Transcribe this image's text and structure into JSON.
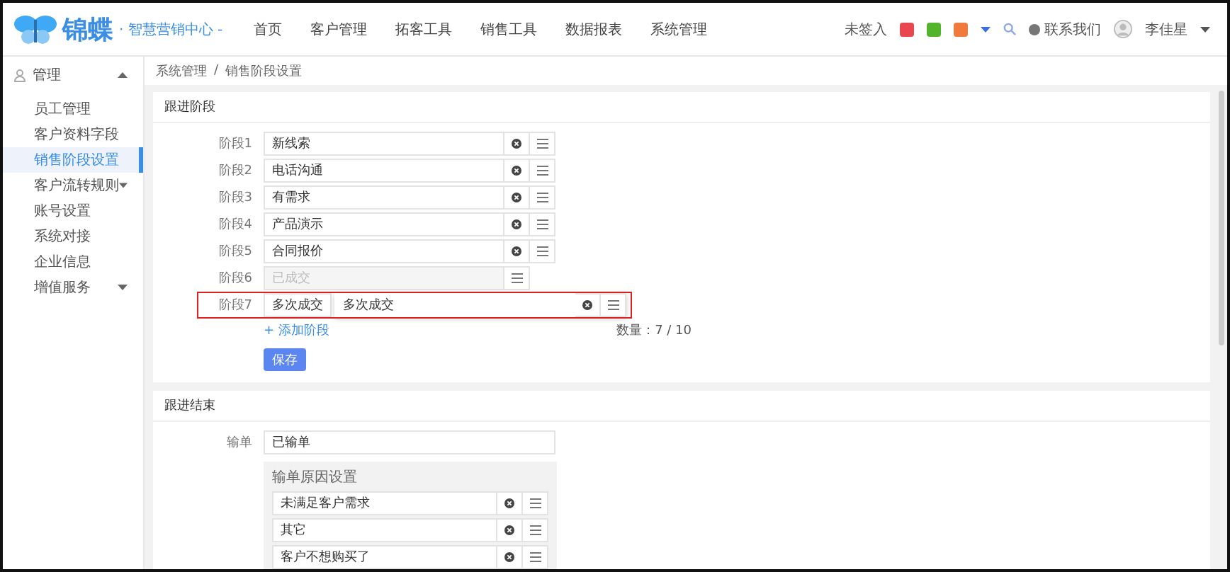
{
  "header": {
    "logo_text": "锦蝶",
    "logo_subtitle": "· 智慧营销中心 -",
    "nav": [
      {
        "label": "首页",
        "selected": false
      },
      {
        "label": "客户管理",
        "selected": false
      },
      {
        "label": "拓客工具",
        "selected": false
      },
      {
        "label": "销售工具",
        "selected": false
      },
      {
        "label": "数据报表",
        "selected": false
      },
      {
        "label": "系统管理",
        "selected": false
      }
    ],
    "status": "未签入",
    "quick_icons": [
      {
        "color": "#e8474f"
      },
      {
        "color": "#52b42c"
      },
      {
        "color": "#f07a3c"
      }
    ],
    "contact": "联系我们",
    "user": "李佳星"
  },
  "sidebar": {
    "group": {
      "label": "管理",
      "expanded": true
    },
    "items": [
      {
        "label": "员工管理",
        "selected": false,
        "has_children": false
      },
      {
        "label": "客户资料字段",
        "selected": false,
        "has_children": false
      },
      {
        "label": "销售阶段设置",
        "selected": true,
        "has_children": false
      },
      {
        "label": "客户流转规则",
        "selected": false,
        "has_children": true
      },
      {
        "label": "账号设置",
        "selected": false,
        "has_children": false
      },
      {
        "label": "系统对接",
        "selected": false,
        "has_children": false
      },
      {
        "label": "企业信息",
        "selected": false,
        "has_children": false
      },
      {
        "label": "增值服务",
        "selected": false,
        "has_children": true
      }
    ]
  },
  "breadcrumb": {
    "items": [
      "系统管理",
      "销售阶段设置"
    ],
    "separator": "/"
  },
  "stages_card": {
    "title": "跟进阶段",
    "stages": [
      {
        "label": "阶段1",
        "value": "新线索",
        "disabled": false,
        "dragging": false
      },
      {
        "label": "阶段2",
        "value": "电话沟通",
        "disabled": false,
        "dragging": false
      },
      {
        "label": "阶段3",
        "value": "有需求",
        "disabled": false,
        "dragging": false
      },
      {
        "label": "阶段4",
        "value": "产品演示",
        "disabled": false,
        "dragging": false
      },
      {
        "label": "阶段5",
        "value": "合同报价",
        "disabled": false,
        "dragging": false
      },
      {
        "label": "阶段6",
        "value": "已成交",
        "disabled": true,
        "dragging": false
      },
      {
        "label": "阶段7",
        "value": "多次成交",
        "disabled": false,
        "dragging": true,
        "ghost_value": "多次成交"
      }
    ],
    "add_link": "+ 添加阶段",
    "count": "数量：7 / 10",
    "save": "保存"
  },
  "end_card": {
    "title": "跟进结束",
    "lost_label": "输单",
    "lost_value": "已输单",
    "reasons_title": "输单原因设置",
    "reasons": [
      "未满足客户需求",
      "其它",
      "客户不想购买了"
    ]
  }
}
